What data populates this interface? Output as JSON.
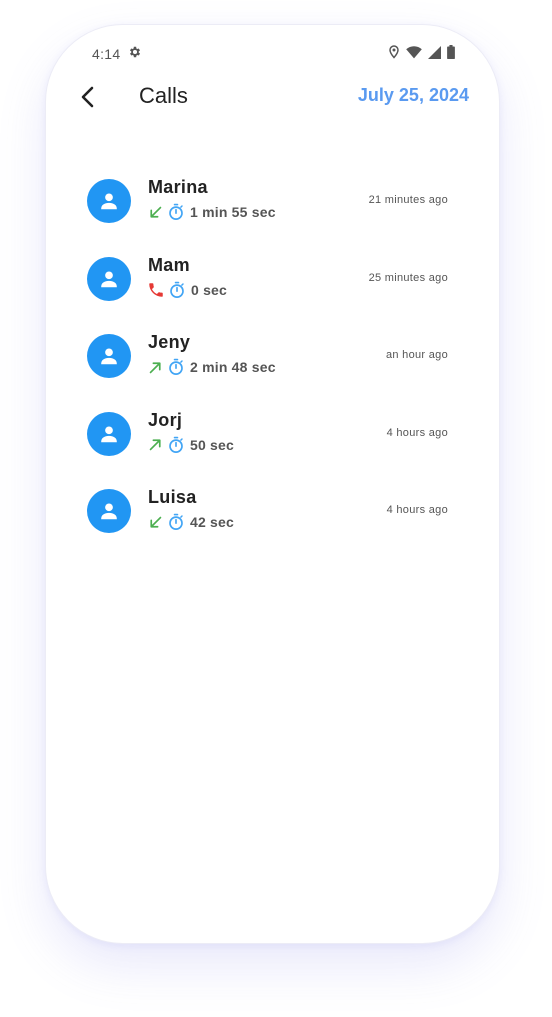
{
  "status_bar": {
    "time": "4:14",
    "icons": [
      "gear-icon",
      "location-icon",
      "wifi-icon",
      "signal-icon",
      "battery-icon"
    ]
  },
  "header": {
    "back_icon": "chevron-left-icon",
    "title": "Calls",
    "date": "July 25, 2024"
  },
  "colors": {
    "accent": "#5a9af0",
    "avatar": "#2196f3",
    "incoming": "#4caf50",
    "outgoing": "#4caf50",
    "missed": "#e53935",
    "timer": "#42a5f5"
  },
  "calls": [
    {
      "name": "Marina",
      "type": "incoming",
      "duration": "1 min 55 sec",
      "time_ago": "21 minutes ago"
    },
    {
      "name": "Mam",
      "type": "missed",
      "duration": "0 sec",
      "time_ago": "25 minutes ago"
    },
    {
      "name": "Jeny",
      "type": "outgoing",
      "duration": "2 min 48 sec",
      "time_ago": "an hour ago"
    },
    {
      "name": "Jorj",
      "type": "outgoing",
      "duration": "50 sec",
      "time_ago": "4 hours ago"
    },
    {
      "name": "Luisa",
      "type": "incoming",
      "duration": "42 sec",
      "time_ago": "4 hours ago"
    }
  ]
}
